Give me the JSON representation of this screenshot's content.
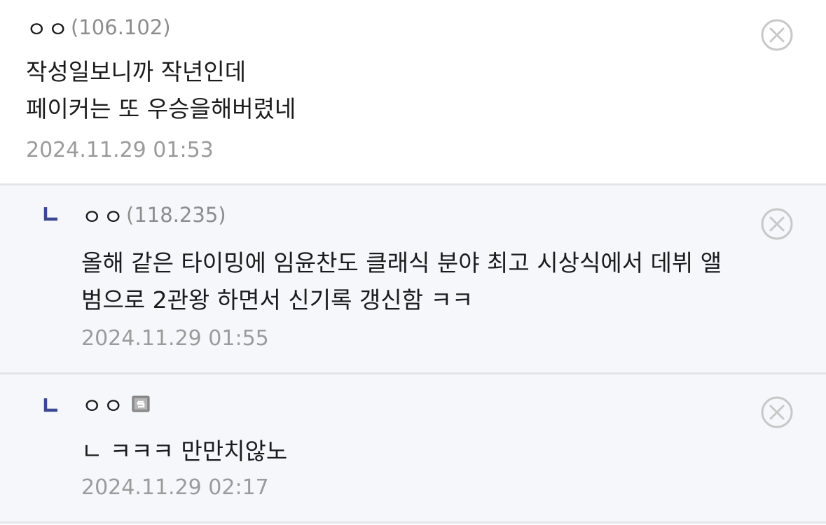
{
  "comments": [
    {
      "nickname": "ㅇㅇ",
      "ip": "(106.102)",
      "lines": [
        "작성일보니까 작년인데",
        "페이커는 또 우승을해버렸네"
      ],
      "date": "2024.11.29 01:53"
    },
    {
      "nickname": "ㅇㅇ",
      "ip": "(118.235)",
      "lines": [
        "올해 같은 타이밍에 임윤찬도 클래식 분야 최고 시상식에서 데뷔 앨",
        "범으로 2관왕 하면서 신기록 갱신함 ㅋㅋ"
      ],
      "date": "2024.11.29 01:55"
    },
    {
      "nickname": "ㅇㅇ",
      "lines": [
        "ㄴ ㅋㅋㅋ 만만치않노"
      ],
      "date": "2024.11.29 02:17"
    }
  ],
  "icons": {
    "reply": "reply-arrow-icon",
    "delete": "close-circle-icon",
    "badge": "fixed-nick-badge-icon"
  },
  "colors": {
    "reply_bg": "#f6f7fb",
    "reply_mark": "#3b4891",
    "divider": "#e3e4e8",
    "meta_text": "#9b9b9b"
  }
}
